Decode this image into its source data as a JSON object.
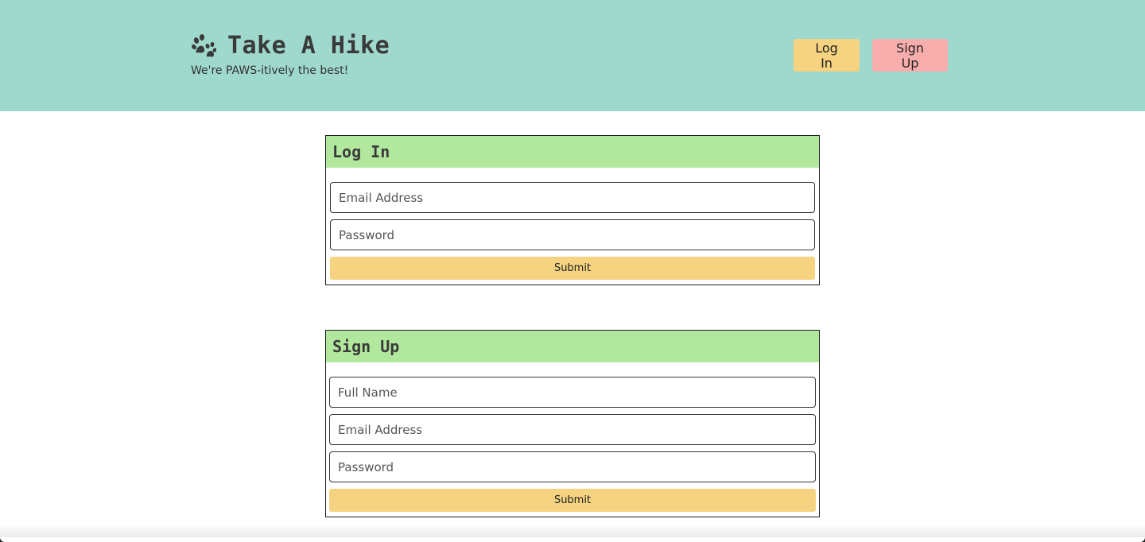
{
  "header": {
    "title": "Take A Hike",
    "tagline": "We're PAWS-itively the best!",
    "login_label": "Log In",
    "signup_label": "Sign Up",
    "logo_icon": "paw-icon",
    "colors": {
      "background": "#9fd8cd",
      "login_button": "#f5d380",
      "signup_button": "#f8adad"
    }
  },
  "login_form": {
    "title": "Log In",
    "email_placeholder": "Email Address",
    "password_placeholder": "Password",
    "submit_label": "Submit"
  },
  "signup_form": {
    "title": "Sign Up",
    "name_placeholder": "Full Name",
    "email_placeholder": "Email Address",
    "password_placeholder": "Password",
    "submit_label": "Submit"
  },
  "colors": {
    "card_header": "#b2e89e",
    "submit_button": "#f5d380"
  }
}
